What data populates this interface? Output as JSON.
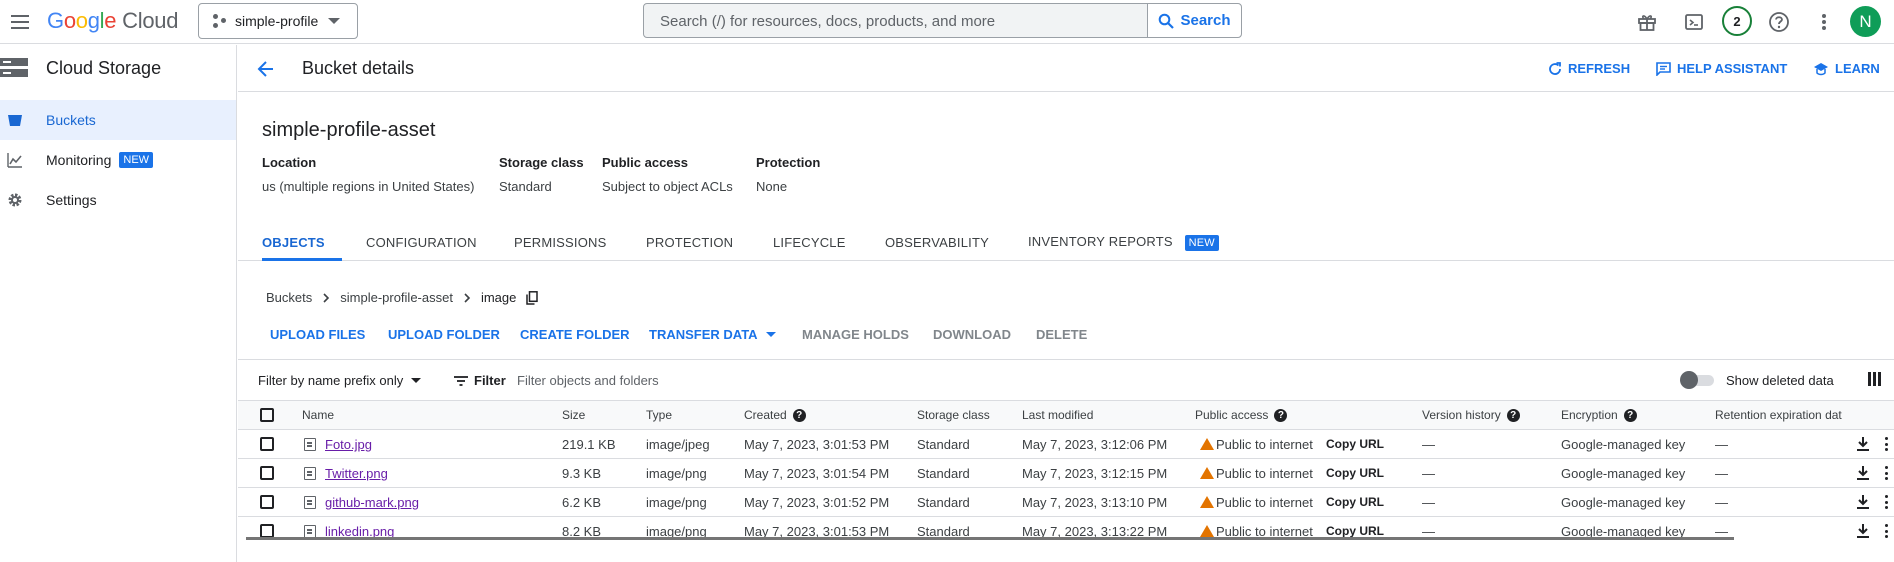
{
  "topbar": {
    "logo_google": "Google",
    "logo_cloud": "Cloud",
    "project": "simple-profile",
    "search_placeholder": "Search (/) for resources, docs, products, and more",
    "search_button": "Search",
    "notifications_count": "2",
    "avatar_letter": "N"
  },
  "sidebar": {
    "product": "Cloud Storage",
    "items": [
      {
        "label": "Buckets",
        "active": true
      },
      {
        "label": "Monitoring",
        "badge": "NEW"
      },
      {
        "label": "Settings"
      }
    ]
  },
  "header": {
    "title": "Bucket details",
    "actions": [
      "REFRESH",
      "HELP ASSISTANT",
      "LEARN"
    ]
  },
  "bucket": {
    "name": "simple-profile-asset",
    "meta": [
      {
        "key": "Location",
        "value": "us (multiple regions in United States)"
      },
      {
        "key": "Storage class",
        "value": "Standard"
      },
      {
        "key": "Public access",
        "value": "Subject to object ACLs"
      },
      {
        "key": "Protection",
        "value": "None"
      }
    ]
  },
  "tabs": [
    {
      "label": "OBJECTS",
      "active": true
    },
    {
      "label": "CONFIGURATION"
    },
    {
      "label": "PERMISSIONS"
    },
    {
      "label": "PROTECTION"
    },
    {
      "label": "LIFECYCLE"
    },
    {
      "label": "OBSERVABILITY"
    },
    {
      "label": "INVENTORY REPORTS",
      "badge": "NEW"
    }
  ],
  "breadcrumb": [
    "Buckets",
    "simple-profile-asset",
    "image"
  ],
  "toolbar": {
    "enabled": [
      "UPLOAD FILES",
      "UPLOAD FOLDER",
      "CREATE FOLDER",
      "TRANSFER DATA"
    ],
    "disabled": [
      "MANAGE HOLDS",
      "DOWNLOAD",
      "DELETE"
    ]
  },
  "filter": {
    "prefix": "Filter by name prefix only",
    "filter_label": "Filter",
    "placeholder": "Filter objects and folders",
    "show_deleted": "Show deleted data"
  },
  "table": {
    "columns": [
      "Name",
      "Size",
      "Type",
      "Created",
      "Storage class",
      "Last modified",
      "Public access",
      "Version history",
      "Encryption",
      "Retention expiration dat"
    ],
    "copy_url": "Copy URL",
    "rows": [
      {
        "name": "Foto.jpg",
        "size": "219.1 KB",
        "type": "image/jpeg",
        "created": "May 7, 2023, 3:01:53 PM",
        "storage": "Standard",
        "modified": "May 7, 2023, 3:12:06 PM",
        "access": "Public to internet",
        "version": "—",
        "encryption": "Google-managed key",
        "retention": "—"
      },
      {
        "name": "Twitter.png",
        "size": "9.3 KB",
        "type": "image/png",
        "created": "May 7, 2023, 3:01:54 PM",
        "storage": "Standard",
        "modified": "May 7, 2023, 3:12:15 PM",
        "access": "Public to internet",
        "version": "—",
        "encryption": "Google-managed key",
        "retention": "—"
      },
      {
        "name": "github-mark.png",
        "size": "6.2 KB",
        "type": "image/png",
        "created": "May 7, 2023, 3:01:52 PM",
        "storage": "Standard",
        "modified": "May 7, 2023, 3:13:10 PM",
        "access": "Public to internet",
        "version": "—",
        "encryption": "Google-managed key",
        "retention": "—"
      },
      {
        "name": "linkedin.png",
        "size": "8.2 KB",
        "type": "image/png",
        "created": "May 7, 2023, 3:01:53 PM",
        "storage": "Standard",
        "modified": "May 7, 2023, 3:13:22 PM",
        "access": "Public to internet",
        "version": "—",
        "encryption": "Google-managed key",
        "retention": "—"
      }
    ]
  }
}
